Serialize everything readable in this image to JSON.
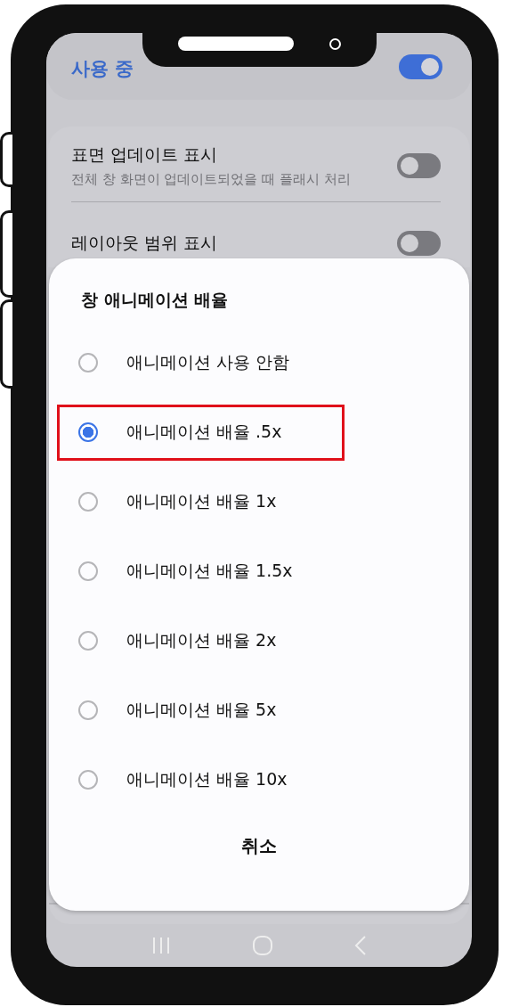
{
  "top_switch": {
    "label": "사용 중",
    "on": true
  },
  "settings": [
    {
      "title": "표면 업데이트 표시",
      "subtitle": "전체 창 화면이 업데이트되었을 때 플래시 처리",
      "on": false
    },
    {
      "title": "레이아웃 범위 표시",
      "on": false
    }
  ],
  "dialog": {
    "title": "창 애니메이션 배율",
    "options": [
      {
        "label": "애니메이션 사용 안함",
        "selected": false
      },
      {
        "label": "애니메이션 배율 .5x",
        "selected": true,
        "highlighted": true
      },
      {
        "label": "애니메이션 배율 1x",
        "selected": false
      },
      {
        "label": "애니메이션 배율 1.5x",
        "selected": false
      },
      {
        "label": "애니메이션 배율 2x",
        "selected": false
      },
      {
        "label": "애니메이션 배율 5x",
        "selected": false
      },
      {
        "label": "애니메이션 배율 10x",
        "selected": false
      }
    ],
    "cancel": "취소"
  }
}
